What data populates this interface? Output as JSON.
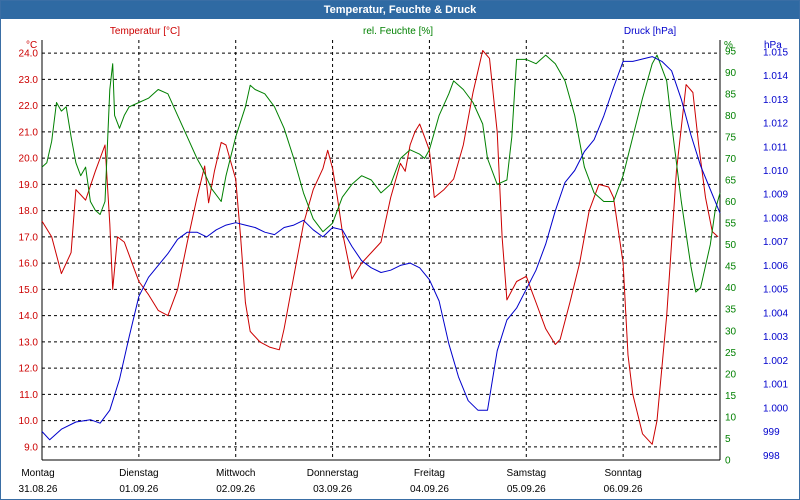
{
  "window": {
    "title": "Temperatur, Feuchte & Druck"
  },
  "chart_data": {
    "type": "line",
    "title": "Temperatur, Feuchte & Druck",
    "grid": true,
    "x": {
      "labels": [
        {
          "day": "Montag",
          "date": "31.08.26"
        },
        {
          "day": "Dienstag",
          "date": "01.09.26"
        },
        {
          "day": "Mittwoch",
          "date": "02.09.26"
        },
        {
          "day": "Donnerstag",
          "date": "03.09.26"
        },
        {
          "day": "Freitag",
          "date": "04.09.26"
        },
        {
          "day": "Samstag",
          "date": "05.09.26"
        },
        {
          "day": "Sonntag",
          "date": "06.09.26"
        }
      ]
    },
    "axes": {
      "temperature": {
        "label": "Temperatur [°C]",
        "unit": "°C",
        "color": "#cc0000",
        "range": [
          8.5,
          24.5
        ],
        "ticks": [
          "9.0",
          "10.0",
          "11.0",
          "12.0",
          "13.0",
          "14.0",
          "15.0",
          "16.0",
          "17.0",
          "18.0",
          "19.0",
          "20.0",
          "21.0",
          "22.0",
          "23.0",
          "24.0"
        ]
      },
      "humidity": {
        "label": "rel. Feuchte [%]",
        "unit": "%",
        "color": "#008000",
        "range": [
          0,
          97.5
        ],
        "ticks": [
          "0",
          "5",
          "10",
          "15",
          "20",
          "25",
          "30",
          "35",
          "40",
          "45",
          "50",
          "55",
          "60",
          "65",
          "70",
          "75",
          "80",
          "85",
          "90",
          "95"
        ]
      },
      "pressure": {
        "label": "Druck [hPa]",
        "unit": "hPa",
        "color": "#0000cc",
        "range": [
          997.8,
          1015.5
        ],
        "ticks": [
          "998",
          "999",
          "1.000",
          "1.001",
          "1.002",
          "1.003",
          "1.004",
          "1.005",
          "1.006",
          "1.007",
          "1.008",
          "1.009",
          "1.010",
          "1.011",
          "1.012",
          "1.013",
          "1.014",
          "1.015"
        ]
      }
    },
    "series": [
      {
        "name": "Temperatur [°C]",
        "axis": "temperature",
        "color": "#cc0000",
        "points": [
          [
            0.0,
            17.6
          ],
          [
            0.1,
            17.0
          ],
          [
            0.2,
            15.6
          ],
          [
            0.3,
            16.4
          ],
          [
            0.35,
            18.8
          ],
          [
            0.45,
            18.4
          ],
          [
            0.55,
            19.5
          ],
          [
            0.65,
            20.5
          ],
          [
            0.7,
            17.5
          ],
          [
            0.73,
            15.0
          ],
          [
            0.78,
            17.0
          ],
          [
            0.85,
            16.8
          ],
          [
            0.9,
            16.3
          ],
          [
            0.95,
            15.8
          ],
          [
            1.0,
            15.3
          ],
          [
            1.1,
            14.8
          ],
          [
            1.2,
            14.2
          ],
          [
            1.3,
            14.0
          ],
          [
            1.4,
            15.0
          ],
          [
            1.5,
            16.8
          ],
          [
            1.6,
            18.5
          ],
          [
            1.68,
            19.7
          ],
          [
            1.72,
            18.3
          ],
          [
            1.78,
            19.5
          ],
          [
            1.85,
            20.6
          ],
          [
            1.9,
            20.5
          ],
          [
            2.0,
            19.2
          ],
          [
            2.05,
            17.0
          ],
          [
            2.1,
            14.5
          ],
          [
            2.15,
            13.4
          ],
          [
            2.25,
            13.0
          ],
          [
            2.35,
            12.8
          ],
          [
            2.45,
            12.7
          ],
          [
            2.5,
            13.5
          ],
          [
            2.6,
            15.5
          ],
          [
            2.7,
            17.5
          ],
          [
            2.8,
            18.8
          ],
          [
            2.9,
            19.6
          ],
          [
            2.95,
            20.3
          ],
          [
            3.0,
            19.6
          ],
          [
            3.05,
            18.5
          ],
          [
            3.1,
            17.2
          ],
          [
            3.2,
            15.4
          ],
          [
            3.3,
            16.0
          ],
          [
            3.4,
            16.4
          ],
          [
            3.5,
            16.8
          ],
          [
            3.6,
            18.5
          ],
          [
            3.7,
            19.8
          ],
          [
            3.75,
            19.5
          ],
          [
            3.8,
            20.5
          ],
          [
            3.85,
            21.0
          ],
          [
            3.9,
            21.3
          ],
          [
            3.95,
            20.8
          ],
          [
            4.0,
            20.3
          ],
          [
            4.05,
            18.5
          ],
          [
            4.15,
            18.8
          ],
          [
            4.25,
            19.2
          ],
          [
            4.35,
            20.5
          ],
          [
            4.45,
            22.5
          ],
          [
            4.55,
            24.1
          ],
          [
            4.62,
            23.8
          ],
          [
            4.7,
            21.0
          ],
          [
            4.75,
            17.0
          ],
          [
            4.8,
            14.6
          ],
          [
            4.9,
            15.3
          ],
          [
            5.0,
            15.5
          ],
          [
            5.05,
            15.0
          ],
          [
            5.1,
            14.5
          ],
          [
            5.2,
            13.5
          ],
          [
            5.3,
            12.9
          ],
          [
            5.35,
            13.1
          ],
          [
            5.45,
            14.5
          ],
          [
            5.55,
            16.0
          ],
          [
            5.65,
            18.0
          ],
          [
            5.75,
            19.0
          ],
          [
            5.85,
            18.9
          ],
          [
            5.9,
            18.5
          ],
          [
            6.0,
            16.0
          ],
          [
            6.05,
            12.5
          ],
          [
            6.1,
            11.0
          ],
          [
            6.2,
            9.5
          ],
          [
            6.3,
            9.1
          ],
          [
            6.35,
            10.0
          ],
          [
            6.45,
            14.0
          ],
          [
            6.55,
            19.5
          ],
          [
            6.65,
            22.8
          ],
          [
            6.72,
            22.5
          ],
          [
            6.78,
            20.5
          ],
          [
            6.85,
            18.5
          ],
          [
            6.92,
            17.2
          ],
          [
            6.98,
            17.0
          ]
        ]
      },
      {
        "name": "rel. Feuchte [%]",
        "axis": "humidity",
        "color": "#008000",
        "points": [
          [
            0.0,
            68
          ],
          [
            0.05,
            69
          ],
          [
            0.1,
            74
          ],
          [
            0.15,
            83
          ],
          [
            0.2,
            81
          ],
          [
            0.25,
            82
          ],
          [
            0.3,
            75
          ],
          [
            0.35,
            69
          ],
          [
            0.4,
            66
          ],
          [
            0.45,
            68
          ],
          [
            0.5,
            60
          ],
          [
            0.55,
            58
          ],
          [
            0.6,
            57
          ],
          [
            0.65,
            60
          ],
          [
            0.7,
            86
          ],
          [
            0.73,
            92
          ],
          [
            0.75,
            80
          ],
          [
            0.8,
            77
          ],
          [
            0.85,
            80
          ],
          [
            0.9,
            82
          ],
          [
            1.0,
            83
          ],
          [
            1.1,
            84
          ],
          [
            1.2,
            86
          ],
          [
            1.3,
            85
          ],
          [
            1.4,
            80
          ],
          [
            1.5,
            75
          ],
          [
            1.6,
            70
          ],
          [
            1.65,
            68
          ],
          [
            1.75,
            63
          ],
          [
            1.85,
            60
          ],
          [
            1.9,
            66
          ],
          [
            2.0,
            75
          ],
          [
            2.1,
            82
          ],
          [
            2.15,
            87
          ],
          [
            2.2,
            86
          ],
          [
            2.3,
            85
          ],
          [
            2.4,
            82
          ],
          [
            2.5,
            77
          ],
          [
            2.6,
            70
          ],
          [
            2.7,
            62
          ],
          [
            2.8,
            56
          ],
          [
            2.9,
            53
          ],
          [
            3.0,
            55
          ],
          [
            3.1,
            61
          ],
          [
            3.2,
            64
          ],
          [
            3.3,
            66
          ],
          [
            3.4,
            65
          ],
          [
            3.5,
            62
          ],
          [
            3.6,
            64
          ],
          [
            3.65,
            67
          ],
          [
            3.7,
            70
          ],
          [
            3.8,
            72
          ],
          [
            3.9,
            71
          ],
          [
            3.95,
            70
          ],
          [
            4.0,
            72
          ],
          [
            4.1,
            80
          ],
          [
            4.2,
            85
          ],
          [
            4.25,
            88
          ],
          [
            4.35,
            86
          ],
          [
            4.45,
            83
          ],
          [
            4.55,
            78
          ],
          [
            4.6,
            70
          ],
          [
            4.7,
            64
          ],
          [
            4.8,
            65
          ],
          [
            4.85,
            75
          ],
          [
            4.9,
            93
          ],
          [
            5.0,
            93
          ],
          [
            5.1,
            92
          ],
          [
            5.2,
            94
          ],
          [
            5.3,
            92
          ],
          [
            5.4,
            88
          ],
          [
            5.5,
            80
          ],
          [
            5.6,
            68
          ],
          [
            5.7,
            62
          ],
          [
            5.8,
            60
          ],
          [
            5.9,
            60
          ],
          [
            6.0,
            66
          ],
          [
            6.1,
            75
          ],
          [
            6.2,
            84
          ],
          [
            6.3,
            92
          ],
          [
            6.35,
            94
          ],
          [
            6.45,
            88
          ],
          [
            6.5,
            78
          ],
          [
            6.6,
            60
          ],
          [
            6.7,
            45
          ],
          [
            6.75,
            39
          ],
          [
            6.8,
            40
          ],
          [
            6.9,
            50
          ],
          [
            6.95,
            58
          ],
          [
            7.0,
            62
          ]
        ]
      },
      {
        "name": "Druck [hPa]",
        "axis": "pressure",
        "color": "#0000cc",
        "points": [
          [
            0.0,
            999.0
          ],
          [
            0.08,
            998.65
          ],
          [
            0.2,
            999.1
          ],
          [
            0.35,
            999.4
          ],
          [
            0.5,
            999.5
          ],
          [
            0.6,
            999.35
          ],
          [
            0.7,
            999.9
          ],
          [
            0.8,
            1001.2
          ],
          [
            0.9,
            1003.0
          ],
          [
            1.0,
            1004.7
          ],
          [
            1.1,
            1005.5
          ],
          [
            1.2,
            1006.0
          ],
          [
            1.3,
            1006.5
          ],
          [
            1.4,
            1007.1
          ],
          [
            1.5,
            1007.4
          ],
          [
            1.6,
            1007.4
          ],
          [
            1.7,
            1007.2
          ],
          [
            1.8,
            1007.5
          ],
          [
            1.9,
            1007.7
          ],
          [
            2.0,
            1007.8
          ],
          [
            2.1,
            1007.7
          ],
          [
            2.2,
            1007.6
          ],
          [
            2.3,
            1007.4
          ],
          [
            2.4,
            1007.3
          ],
          [
            2.5,
            1007.6
          ],
          [
            2.6,
            1007.7
          ],
          [
            2.7,
            1007.9
          ],
          [
            2.8,
            1007.5
          ],
          [
            2.9,
            1007.2
          ],
          [
            3.0,
            1007.6
          ],
          [
            3.1,
            1007.5
          ],
          [
            3.2,
            1006.8
          ],
          [
            3.3,
            1006.2
          ],
          [
            3.4,
            1005.9
          ],
          [
            3.5,
            1005.7
          ],
          [
            3.6,
            1005.8
          ],
          [
            3.7,
            1006.0
          ],
          [
            3.8,
            1006.1
          ],
          [
            3.9,
            1005.9
          ],
          [
            4.0,
            1005.4
          ],
          [
            4.1,
            1004.5
          ],
          [
            4.2,
            1002.7
          ],
          [
            4.3,
            1001.3
          ],
          [
            4.4,
            1000.3
          ],
          [
            4.5,
            999.9
          ],
          [
            4.6,
            999.9
          ],
          [
            4.7,
            1002.4
          ],
          [
            4.8,
            1003.7
          ],
          [
            4.9,
            1004.2
          ],
          [
            5.0,
            1005.0
          ],
          [
            5.1,
            1005.8
          ],
          [
            5.2,
            1006.9
          ],
          [
            5.3,
            1008.3
          ],
          [
            5.4,
            1009.5
          ],
          [
            5.5,
            1010.0
          ],
          [
            5.6,
            1010.8
          ],
          [
            5.7,
            1011.3
          ],
          [
            5.8,
            1012.3
          ],
          [
            5.9,
            1013.5
          ],
          [
            6.0,
            1014.6
          ],
          [
            6.1,
            1014.6
          ],
          [
            6.2,
            1014.7
          ],
          [
            6.3,
            1014.8
          ],
          [
            6.4,
            1014.6
          ],
          [
            6.5,
            1014.2
          ],
          [
            6.6,
            1013.0
          ],
          [
            6.7,
            1011.5
          ],
          [
            6.8,
            1010.2
          ],
          [
            6.9,
            1009.2
          ],
          [
            6.95,
            1008.7
          ],
          [
            7.0,
            1008.2
          ]
        ]
      }
    ]
  }
}
